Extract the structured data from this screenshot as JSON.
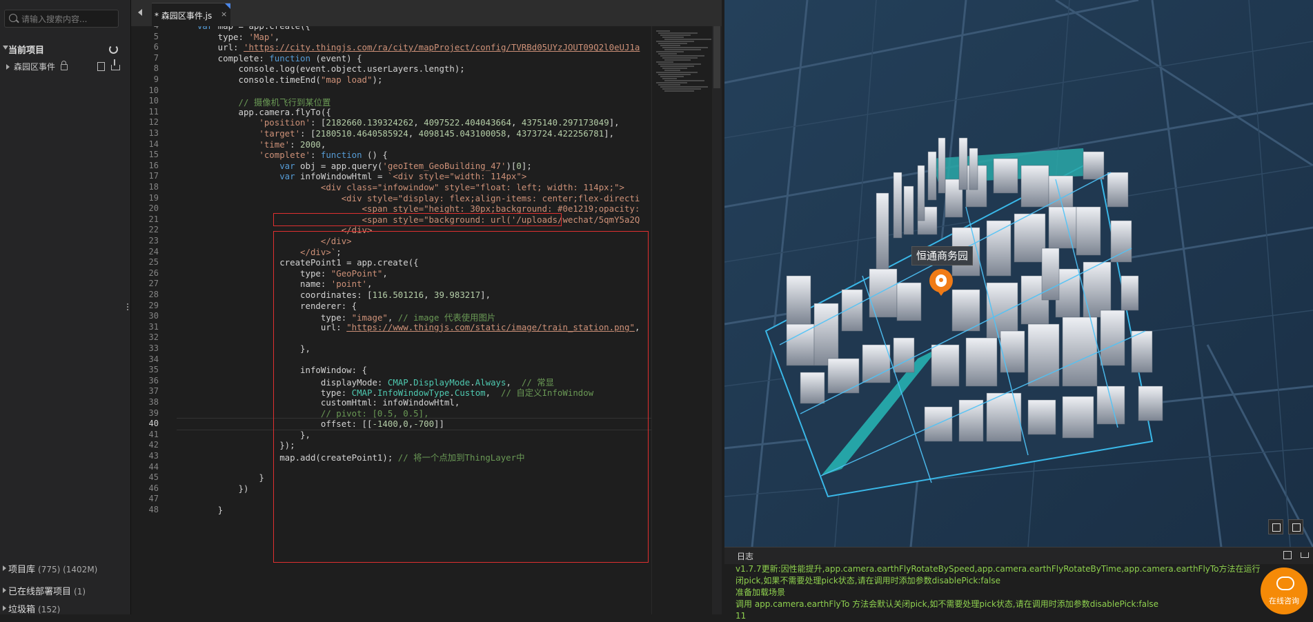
{
  "sidebar": {
    "search_placeholder": "请输入搜索内容...",
    "current_project_label": "当前项目",
    "file_name": "森园区事件",
    "bottom_items": [
      {
        "label": "项目库",
        "count": "(775) (1402M)"
      },
      {
        "label": "已在线部署项目",
        "count": "(1)"
      },
      {
        "label": "垃圾箱",
        "count": "(152)"
      }
    ]
  },
  "editor": {
    "tab_label": "* 森园区事件.js",
    "tab_close": "×",
    "current_line": "40",
    "lines": [
      {
        "n": "4",
        "segs": [
          [
            "",
            "    "
          ],
          [
            "k",
            "var"
          ],
          [
            "",
            " map = app.create({"
          ]
        ]
      },
      {
        "n": "5",
        "segs": [
          [
            "",
            "        type: "
          ],
          [
            "s",
            "'Map'"
          ],
          [
            "",
            ","
          ]
        ]
      },
      {
        "n": "6",
        "segs": [
          [
            "",
            "        url: "
          ],
          [
            "u",
            "'https://city.thingjs.com/ra/city/mapProject/config/TVRBd05UYzJOUT09Q2l0eUJ1a"
          ]
        ]
      },
      {
        "n": "7",
        "segs": [
          [
            "",
            "        complete: "
          ],
          [
            "k",
            "function"
          ],
          [
            "",
            " (event) {"
          ]
        ]
      },
      {
        "n": "8",
        "segs": [
          [
            "",
            "            console.log(event.object.userLayers.length);"
          ]
        ]
      },
      {
        "n": "9",
        "segs": [
          [
            "",
            "            console.timeEnd("
          ],
          [
            "s",
            "\"map load\""
          ],
          [
            "",
            ");"
          ]
        ]
      },
      {
        "n": "10",
        "segs": [
          [
            "",
            ""
          ]
        ]
      },
      {
        "n": "10",
        "segs": [
          [
            "cm",
            "            // 摄像机飞行到某位置"
          ]
        ]
      },
      {
        "n": "11",
        "segs": [
          [
            "",
            "            app.camera.flyTo({"
          ]
        ]
      },
      {
        "n": "12",
        "segs": [
          [
            "",
            "                "
          ],
          [
            "s",
            "'position'"
          ],
          [
            "",
            ": ["
          ],
          [
            "n",
            "2182660.139324262"
          ],
          [
            "",
            ", "
          ],
          [
            "n",
            "4097522.404043664"
          ],
          [
            "",
            ", "
          ],
          [
            "n",
            "4375140.297173049"
          ],
          [
            "",
            "],"
          ]
        ]
      },
      {
        "n": "13",
        "segs": [
          [
            "",
            "                "
          ],
          [
            "s",
            "'target'"
          ],
          [
            "",
            ": ["
          ],
          [
            "n",
            "2180510.4640585924"
          ],
          [
            "",
            ", "
          ],
          [
            "n",
            "4098145.043100058"
          ],
          [
            "",
            ", "
          ],
          [
            "n",
            "4373724.422256781"
          ],
          [
            "",
            "],"
          ]
        ]
      },
      {
        "n": "14",
        "segs": [
          [
            "",
            "                "
          ],
          [
            "s",
            "'time'"
          ],
          [
            "",
            ": "
          ],
          [
            "n",
            "2000"
          ],
          [
            "",
            ","
          ]
        ]
      },
      {
        "n": "15",
        "segs": [
          [
            "",
            "                "
          ],
          [
            "s",
            "'complete'"
          ],
          [
            "",
            ": "
          ],
          [
            "k",
            "function"
          ],
          [
            "",
            " () {"
          ]
        ]
      },
      {
        "n": "16",
        "segs": [
          [
            "",
            "                    "
          ],
          [
            "k",
            "var"
          ],
          [
            "",
            " obj = app.query("
          ],
          [
            "s",
            "'geoItem_GeoBuilding_47'"
          ],
          [
            "",
            ")["
          ],
          [
            "n",
            "0"
          ],
          [
            "",
            "];"
          ]
        ]
      },
      {
        "n": "17",
        "segs": [
          [
            "",
            "                    "
          ],
          [
            "k",
            "var"
          ],
          [
            "",
            " infoWindowHtml = "
          ],
          [
            "s",
            "`<div style=\"width: 114px\">"
          ]
        ]
      },
      {
        "n": "18",
        "segs": [
          [
            "s",
            "                            <div class=\"infowindow\" style=\"float: left; width: 114px;\">"
          ]
        ]
      },
      {
        "n": "19",
        "segs": [
          [
            "s",
            "                                <div style=\"display: flex;align-items: center;flex-directi"
          ]
        ]
      },
      {
        "n": "20",
        "segs": [
          [
            "s",
            "                                    <span style=\"height: 30px;background: #0e1219;opacity:"
          ]
        ]
      },
      {
        "n": "21",
        "segs": [
          [
            "s",
            "                                    <span style=\"background: url('/uploads/wechat/5qmY5a2Q"
          ]
        ]
      },
      {
        "n": "22",
        "segs": [
          [
            "s",
            "                                </div>"
          ]
        ]
      },
      {
        "n": "23",
        "segs": [
          [
            "s",
            "                            </div>"
          ]
        ]
      },
      {
        "n": "24",
        "segs": [
          [
            "s",
            "                        </div>`"
          ],
          [
            "",
            ";"
          ]
        ]
      },
      {
        "n": "25",
        "segs": [
          [
            "",
            "                    createPoint1 = app.create({"
          ]
        ]
      },
      {
        "n": "26",
        "segs": [
          [
            "",
            "                        type: "
          ],
          [
            "s",
            "\"GeoPoint\""
          ],
          [
            "",
            ","
          ]
        ]
      },
      {
        "n": "27",
        "segs": [
          [
            "",
            "                        name: "
          ],
          [
            "s",
            "'point'"
          ],
          [
            "",
            ","
          ]
        ]
      },
      {
        "n": "28",
        "segs": [
          [
            "",
            "                        coordinates: ["
          ],
          [
            "n",
            "116.501216"
          ],
          [
            "",
            ", "
          ],
          [
            "n",
            "39.983217"
          ],
          [
            "",
            "],"
          ]
        ]
      },
      {
        "n": "29",
        "segs": [
          [
            "",
            "                        renderer: {"
          ]
        ]
      },
      {
        "n": "30",
        "segs": [
          [
            "",
            "                            type: "
          ],
          [
            "s",
            "\"image\""
          ],
          [
            "",
            ", "
          ],
          [
            "cm",
            "// image 代表使用图片"
          ]
        ]
      },
      {
        "n": "31",
        "segs": [
          [
            "",
            "                            url: "
          ],
          [
            "u",
            "\"https://www.thingjs.com/static/image/train_station.png\""
          ],
          [
            "",
            ","
          ]
        ]
      },
      {
        "n": "32",
        "segs": [
          [
            "",
            ""
          ]
        ]
      },
      {
        "n": "33",
        "segs": [
          [
            "",
            "                        },"
          ]
        ]
      },
      {
        "n": "34",
        "segs": [
          [
            "",
            ""
          ]
        ]
      },
      {
        "n": "35",
        "segs": [
          [
            "",
            "                        infoWindow: {"
          ]
        ]
      },
      {
        "n": "36",
        "segs": [
          [
            "",
            "                            displayMode: "
          ],
          [
            "cy",
            "CMAP"
          ],
          [
            "",
            "."
          ],
          [
            "cy",
            "DisplayMode"
          ],
          [
            "",
            "."
          ],
          [
            "cy",
            "Always"
          ],
          [
            "",
            ",  "
          ],
          [
            "cm",
            "// 常显"
          ]
        ]
      },
      {
        "n": "37",
        "segs": [
          [
            "",
            "                            type: "
          ],
          [
            "cy",
            "CMAP"
          ],
          [
            "",
            "."
          ],
          [
            "cy",
            "InfoWindowType"
          ],
          [
            "",
            "."
          ],
          [
            "cy",
            "Custom"
          ],
          [
            "",
            ",  "
          ],
          [
            "cm",
            "// 自定义InfoWindow"
          ]
        ]
      },
      {
        "n": "38",
        "segs": [
          [
            "",
            "                            customHtml: infoWindowHtml,"
          ]
        ]
      },
      {
        "n": "39",
        "segs": [
          [
            "cm",
            "                            // pivot: [0.5, 0.5],"
          ]
        ]
      },
      {
        "n": "40",
        "segs": [
          [
            "",
            "                            offset: [["
          ],
          [
            "n",
            "-1400"
          ],
          [
            "",
            ","
          ],
          [
            "n",
            "0"
          ],
          [
            "",
            ","
          ],
          [
            "n",
            "-700"
          ],
          [
            "",
            "]]"
          ]
        ]
      },
      {
        "n": "41",
        "segs": [
          [
            "",
            "                        },"
          ]
        ]
      },
      {
        "n": "42",
        "segs": [
          [
            "",
            "                    });"
          ]
        ]
      },
      {
        "n": "43",
        "segs": [
          [
            "",
            "                    map.add(createPoint1); "
          ],
          [
            "cm",
            "// 将一个点加到ThingLayer中"
          ]
        ]
      },
      {
        "n": "44",
        "segs": [
          [
            "",
            ""
          ]
        ]
      },
      {
        "n": "45",
        "segs": [
          [
            "",
            "                }"
          ]
        ]
      },
      {
        "n": "46",
        "segs": [
          [
            "",
            "            })"
          ]
        ]
      },
      {
        "n": "47",
        "segs": [
          [
            "",
            ""
          ]
        ]
      },
      {
        "n": "48",
        "segs": [
          [
            "",
            "        }"
          ]
        ]
      }
    ]
  },
  "map": {
    "label": "恒通商务园"
  },
  "log": {
    "tab_label": "日志",
    "lines": [
      "v1.7.7更新:因性能提升,app.camera.earthFlyRotateBySpeed,app.camera.earthFlyRotateByTime,app.camera.earthFlyTo方法在运行时会默认关",
      "闭pick,如果不需要处理pick状态,请在调用时添加参数disablePick:false",
      "准备加载场景",
      "调用 app.camera.earthFlyTo 方法会默认关闭pick,如不需要处理pick状态,请在调用时添加参数disablePick:false",
      "11"
    ]
  },
  "chat": {
    "label": "在线咨询"
  },
  "colors": {
    "accent": "#4a86e8",
    "highlight_box": "#e03030",
    "log_text": "#8fd14f",
    "pin": "#f07b16"
  }
}
